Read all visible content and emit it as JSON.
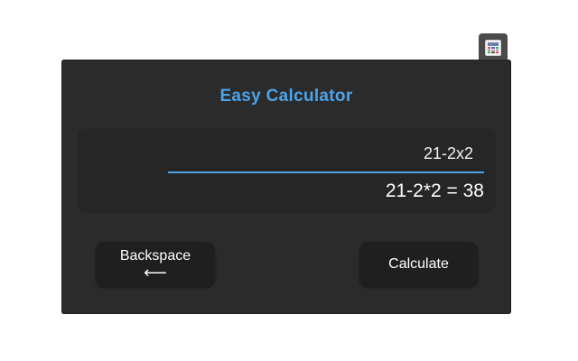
{
  "app": {
    "title": "Easy Calculator",
    "extension_icon": "calculator-icon"
  },
  "display": {
    "expression": "21-2x2",
    "result": "21-2*2 = 38"
  },
  "buttons": {
    "backspace_label": "Backspace",
    "backspace_arrow": "⟵",
    "calculate_label": "Calculate"
  },
  "colors": {
    "accent": "#4da3e8",
    "background": "#2b2b2b",
    "button": "#1f1f1f"
  }
}
